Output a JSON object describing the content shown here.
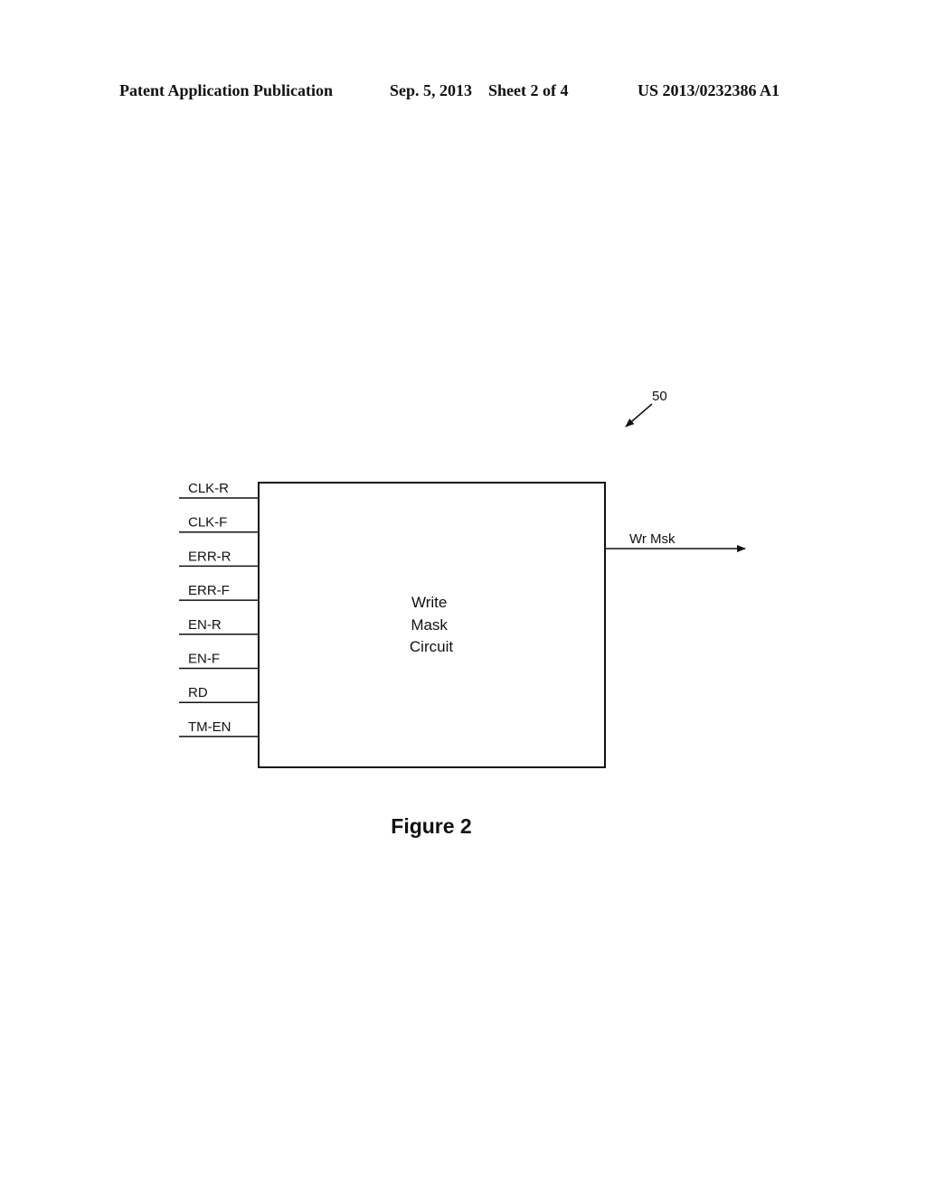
{
  "header": {
    "publication": "Patent Application Publication",
    "date_sheet": "Sep. 5, 2013    Sheet 2 of 4",
    "patent_number": "US 2013/0232386 A1"
  },
  "diagram": {
    "reference_numeral": "50",
    "block_label_lines": [
      "Write",
      "Mask",
      "Circuit"
    ],
    "inputs": [
      "CLK-R",
      "CLK-F",
      "ERR-R",
      "ERR-F",
      "EN-R",
      "EN-F",
      "RD",
      "TM-EN"
    ],
    "output": "Wr Msk"
  },
  "figure_caption": "Figure 2"
}
